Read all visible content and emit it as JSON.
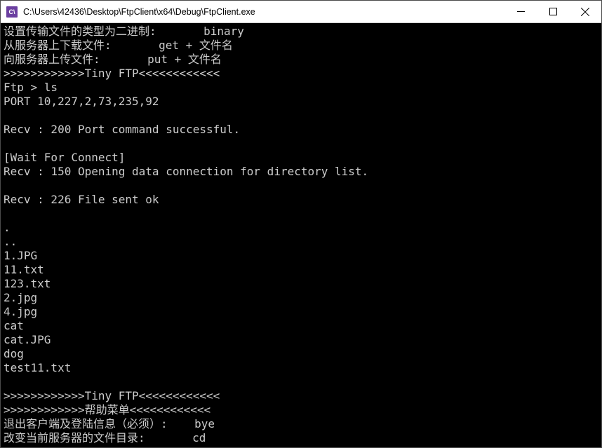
{
  "window": {
    "icon_text": "C\\",
    "title": "C:\\Users\\42436\\Desktop\\FtpClient\\x64\\Debug\\FtpClient.exe"
  },
  "lines": [
    "设置传输文件的类型为二进制:       binary",
    "从服务器上下载文件:       get + 文件名",
    "向服务器上传文件:       put + 文件名",
    ">>>>>>>>>>>>Tiny FTP<<<<<<<<<<<<",
    "Ftp > ls",
    "PORT 10,227,2,73,235,92",
    "",
    "Recv : 200 Port command successful.",
    "",
    "[Wait For Connect]",
    "Recv : 150 Opening data connection for directory list.",
    "",
    "Recv : 226 File sent ok",
    "",
    ".",
    "..",
    "1.JPG",
    "11.txt",
    "123.txt",
    "2.jpg",
    "4.jpg",
    "cat",
    "cat.JPG",
    "dog",
    "test11.txt",
    "",
    ">>>>>>>>>>>>Tiny FTP<<<<<<<<<<<<",
    ">>>>>>>>>>>>帮助菜单<<<<<<<<<<<<",
    "退出客户端及登陆信息（必须）:    bye",
    "改变当前服务器的文件目录:       cd"
  ]
}
